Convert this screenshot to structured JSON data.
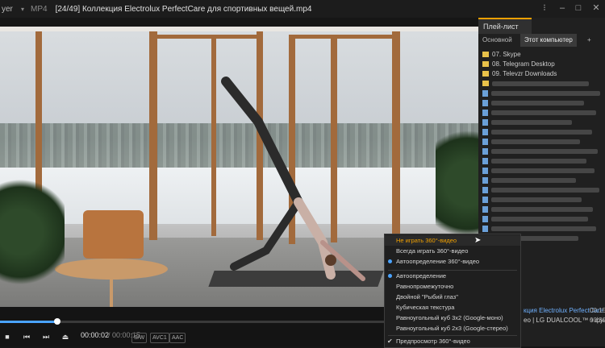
{
  "titlebar": {
    "app": "yer",
    "format": "MP4",
    "title": "[24/49] Коллекция Electrolux PerfectCare для спортивных вещей.mp4",
    "buttons": [
      "⁝",
      "–",
      "□",
      "✕"
    ]
  },
  "controls": {
    "time_current": "00:00:02",
    "time_total": "/ 00:00:15",
    "badges": [
      "S/W",
      "AVC1",
      "AAC"
    ],
    "progress": 0.12
  },
  "playlist": {
    "title": "Плей-лист",
    "tabs": [
      "Основной",
      "Этот компьютер"
    ],
    "add": "+",
    "folders": [
      "07. Skype",
      "08. Telegram Desktop",
      "09. Televzr Downloads"
    ],
    "bottom_items": [
      "кция Electrolux PerfectCare ...",
      "ео | LG DUALCOOL™ з функціє"
    ],
    "bottom_durations": [
      "00:15",
      "00:30"
    ]
  },
  "menu": {
    "items": [
      {
        "label": "Не играть 360°-видео",
        "state": "highlight"
      },
      {
        "label": "Всегда играть 360°-видео",
        "state": ""
      },
      {
        "label": "Автоопределение 360°-видео",
        "state": "dot"
      },
      {
        "label": "Автоопределение",
        "state": "dot"
      },
      {
        "label": "Равнопромежуточно",
        "state": ""
      },
      {
        "label": "Двойной \"Рыбий глаз\"",
        "state": ""
      },
      {
        "label": "Кубическая текстура",
        "state": ""
      },
      {
        "label": "Равноугольный куб 3x2 (Google-моно)",
        "state": ""
      },
      {
        "label": "Равноугольный куб 2x3 (Google-стерео)",
        "state": ""
      },
      {
        "label": "Предпросмотр 360°-видео",
        "state": "check"
      }
    ]
  },
  "colors": {
    "accent": "#f0a000",
    "blue": "#4aa3ff",
    "bg": "#161616"
  }
}
